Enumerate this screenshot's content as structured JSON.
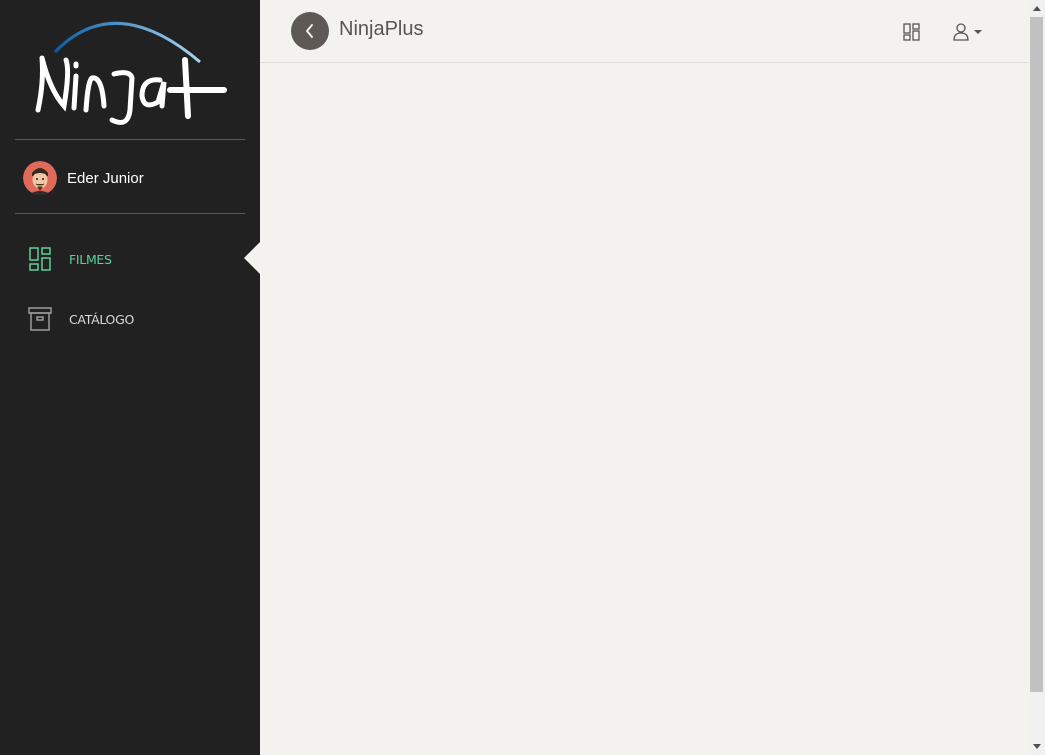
{
  "sidebar": {
    "logo_text": "Ninja+",
    "profile": {
      "name": "Eder Junior"
    },
    "nav": [
      {
        "label": "FILMES",
        "icon": "dashboard-icon",
        "active": true
      },
      {
        "label": "CATÁLOGO",
        "icon": "archive-box-icon",
        "active": false
      }
    ]
  },
  "header": {
    "title": "NinjaPlus",
    "back_icon": "chevron-left-icon",
    "grid_icon": "dashboard-icon",
    "user_icon": "user-icon"
  },
  "colors": {
    "sidebar_bg": "#212121",
    "main_bg": "#f3f2ef",
    "accent": "#5fcf96",
    "back_button": "#5e5955"
  }
}
